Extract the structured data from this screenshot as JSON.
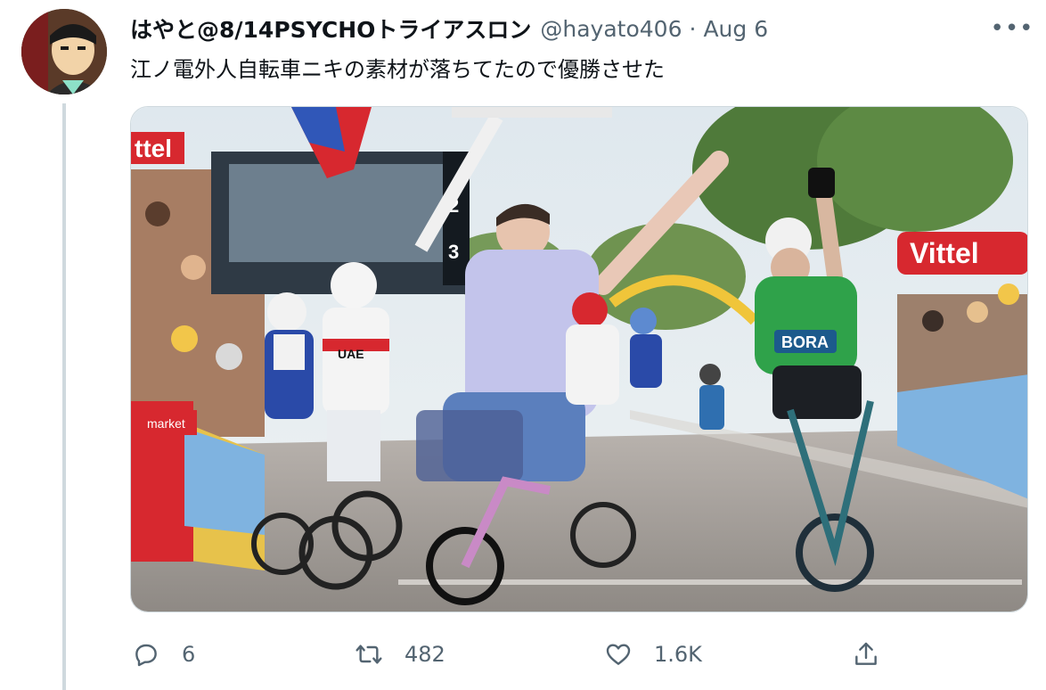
{
  "tweet": {
    "display_name": "はやと@8/14PSYCHOトライアスロン",
    "handle": "@hayato406",
    "separator": "·",
    "date": "Aug 6",
    "more_label": "•••",
    "text": "江ノ電外人自転車ニキの素材が落ちてたので優勝させた",
    "media": {
      "sign_vittel": "Vittel",
      "sign_vittel_short": "ttel",
      "sign_market": "market",
      "screen_numbers": [
        "2",
        "3"
      ],
      "jersey_uae": "UAE",
      "jersey_bora": "BORA"
    }
  },
  "actions": {
    "reply": {
      "icon": "reply-icon",
      "count": "6"
    },
    "retweet": {
      "icon": "retweet-icon",
      "count": "482"
    },
    "like": {
      "icon": "heart-icon",
      "count": "1.6K"
    },
    "share": {
      "icon": "share-icon"
    }
  },
  "colors": {
    "text": "#0f1419",
    "secondary": "#536471",
    "border": "#cfd9de",
    "vittel_red": "#d7282f",
    "green_jersey": "#2fa24a"
  }
}
